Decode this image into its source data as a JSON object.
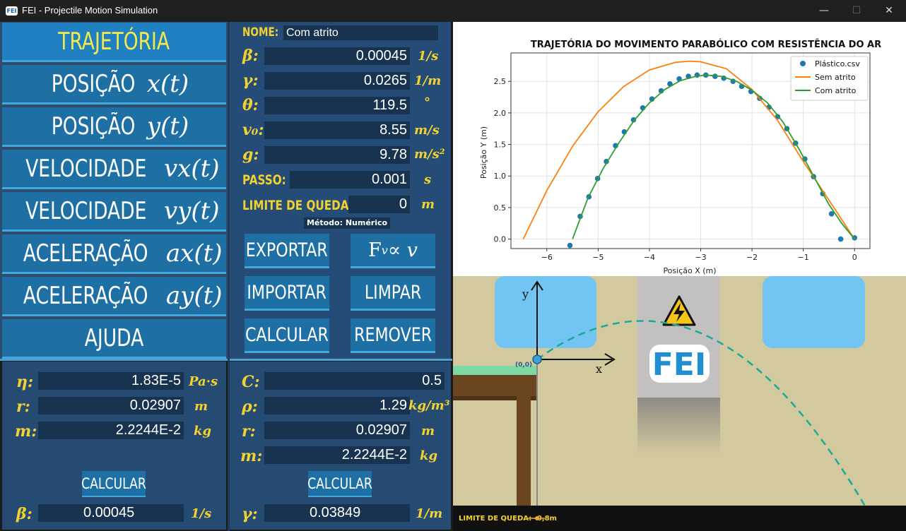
{
  "window": {
    "title": "FEI - Projectile Motion Simulation",
    "logo": "FEI",
    "minimize": "—",
    "maximize": "☐",
    "close": "✕"
  },
  "menu": [
    {
      "text": "TRAJETÓRIA",
      "math": ""
    },
    {
      "text": "POSIÇÃO",
      "math": "x(t)"
    },
    {
      "text": "POSIÇÃO",
      "math": "y(t)"
    },
    {
      "text": "VELOCIDADE",
      "math": "vx(t)"
    },
    {
      "text": "VELOCIDADE",
      "math": "vy(t)"
    },
    {
      "text": "ACELERAÇÃO",
      "math": "ax(t)"
    },
    {
      "text": "ACELERAÇÃO",
      "math": "ay(t)"
    },
    {
      "text": "AJUDA",
      "math": ""
    }
  ],
  "params": {
    "nome_label": "NOME:",
    "nome": "Com atrito",
    "beta_label": "β:",
    "beta": "0.00045",
    "beta_unit": "1/s",
    "gamma_label": "γ:",
    "gamma": "0.0265",
    "gamma_unit": "1/m",
    "theta_label": "θ:",
    "theta": "119.5",
    "theta_unit": "°",
    "v0_label": "v₀:",
    "v0": "8.55",
    "v0_unit": "m/s",
    "g_label": "g:",
    "g": "9.78",
    "g_unit": "m/s²",
    "passo_label": "PASSO:",
    "passo": "0.001",
    "passo_unit": "s",
    "limite_label": "LIMITE DE QUEDA:",
    "limite": "0",
    "limite_unit": "m",
    "metodo": "Método: Numérico"
  },
  "actions": {
    "exportar": "EXPORTAR",
    "fv": "F",
    "fv_sub": "v",
    "fv_rest": " ∝ v",
    "importar": "IMPORTAR",
    "limpar": "LIMPAR",
    "calcular": "CALCULAR",
    "remover": "REMOVER"
  },
  "linear": {
    "eta_label": "η:",
    "eta": "1.83E-5",
    "eta_unit": "Pa·s",
    "r_label": "r:",
    "r": "0.02907",
    "r_unit": "m",
    "m_label": "m:",
    "m": "2.2244E-2",
    "m_unit": "kg",
    "calc": "CALCULAR",
    "beta_label": "β:",
    "beta": "0.00045",
    "beta_unit": "1/s"
  },
  "quadratic": {
    "c_label": "C:",
    "c": "0.5",
    "rho_label": "ρ:",
    "rho": "1.29",
    "rho_unit": "kg/m³",
    "r_label": "r:",
    "r": "0.02907",
    "r_unit": "m",
    "m_label": "m:",
    "m": "2.2244E-2",
    "m_unit": "kg",
    "calc": "CALCULAR",
    "gamma_label": "γ:",
    "gamma": "0.03849",
    "gamma_unit": "1/m"
  },
  "scene": {
    "y_axis": "y",
    "x_axis": "x",
    "origin": "(0,0)",
    "logo": "FEI",
    "limite_text": "LIMITE DE QUEDA: -0,8m",
    "warning_icon": "high-voltage-icon"
  },
  "colors": {
    "accent": "#42a8dc",
    "button": "#1e6fa4",
    "label": "#f2d230",
    "active_text": "#f5e94b"
  },
  "chart_data": {
    "type": "line",
    "title": "TRAJETÓRIA DO MOVIMENTO PARABÓLICO COM RESISTÊNCIA DO AR",
    "xlabel": "Posição X (m)",
    "ylabel": "Posição Y (m)",
    "xlim": [
      -6.7,
      0.3
    ],
    "ylim": [
      -0.15,
      2.95
    ],
    "xticks": [
      -6,
      -5,
      -4,
      -3,
      -2,
      -1,
      0
    ],
    "yticks": [
      0.0,
      0.5,
      1.0,
      1.5,
      2.0,
      2.5
    ],
    "grid": true,
    "legend": "top-right",
    "series": [
      {
        "name": "Plástico.csv",
        "kind": "scatter",
        "color": "#1f77b4",
        "x": [
          -5.55,
          -5.35,
          -5.18,
          -5.01,
          -4.84,
          -4.66,
          -4.49,
          -4.31,
          -4.13,
          -3.95,
          -3.77,
          -3.6,
          -3.42,
          -3.24,
          -3.07,
          -2.9,
          -2.72,
          -2.55,
          -2.37,
          -2.2,
          -2.02,
          -1.85,
          -1.67,
          -1.5,
          -1.32,
          -1.15,
          -0.97,
          -0.8,
          -0.62,
          -0.45,
          -0.27,
          0.0
        ],
        "y": [
          -0.1,
          0.36,
          0.67,
          0.96,
          1.23,
          1.48,
          1.7,
          1.89,
          2.08,
          2.22,
          2.35,
          2.46,
          2.54,
          2.58,
          2.6,
          2.6,
          2.58,
          2.55,
          2.5,
          2.42,
          2.34,
          2.23,
          2.09,
          1.94,
          1.75,
          1.52,
          1.27,
          0.99,
          0.72,
          0.4,
          0.0,
          0.02
        ]
      },
      {
        "name": "Sem atrito",
        "kind": "line",
        "color": "#ff7f0e",
        "x": [
          -6.46,
          -6.0,
          -5.5,
          -5.0,
          -4.5,
          -4.0,
          -3.5,
          -3.21,
          -3.0,
          -2.5,
          -2.0,
          -1.5,
          -1.0,
          -0.5,
          0.0
        ],
        "y": [
          0.0,
          0.77,
          1.47,
          2.02,
          2.42,
          2.68,
          2.8,
          2.82,
          2.81,
          2.7,
          2.37,
          1.88,
          1.23,
          0.62,
          0.0
        ]
      },
      {
        "name": "Com atrito",
        "kind": "line",
        "color": "#2ca02c",
        "x": [
          -5.5,
          -5.2,
          -4.9,
          -4.6,
          -4.3,
          -4.0,
          -3.7,
          -3.4,
          -3.1,
          -2.9,
          -2.6,
          -2.3,
          -2.0,
          -1.7,
          -1.4,
          -1.1,
          -0.8,
          -0.5,
          -0.25,
          0.0
        ],
        "y": [
          0.0,
          0.65,
          1.12,
          1.52,
          1.88,
          2.16,
          2.37,
          2.51,
          2.58,
          2.6,
          2.58,
          2.5,
          2.36,
          2.16,
          1.86,
          1.45,
          1.0,
          0.55,
          0.25,
          0.0
        ]
      }
    ]
  }
}
